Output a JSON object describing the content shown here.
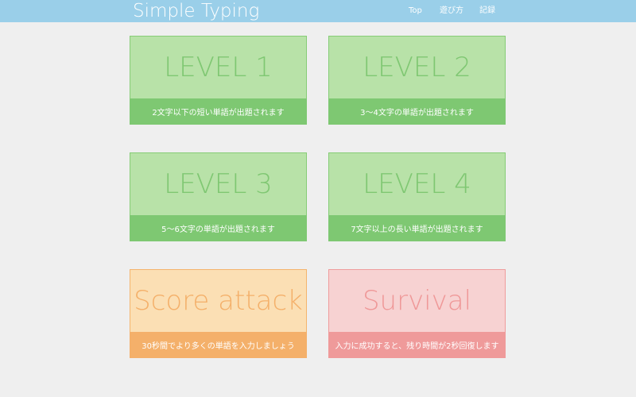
{
  "header": {
    "brand": "Simple Typing",
    "nav": [
      {
        "label": "Top"
      },
      {
        "label": "遊び方"
      },
      {
        "label": "記録"
      }
    ]
  },
  "modes": [
    {
      "title": "LEVEL 1",
      "description": "2文字以下の短い単語が出題されます",
      "color": "#7ec872"
    },
    {
      "title": "LEVEL 2",
      "description": "3〜4文字の単語が出題されます",
      "color": "#7ec872"
    },
    {
      "title": "LEVEL 3",
      "description": "5〜6文字の単語が出題されます",
      "color": "#7ec872"
    },
    {
      "title": "LEVEL 4",
      "description": "7文字以上の長い単語が出題されます",
      "color": "#7ec872"
    },
    {
      "title": "Score attack",
      "description": "30秒間でより多くの単語を入力しましょう",
      "color": "#f4b06a"
    },
    {
      "title": "Survival",
      "description": "入力に成功すると、残り時間が2秒回復します",
      "color": "#ef9a9a"
    }
  ],
  "colors": {
    "navbar": "#9acfe9",
    "background": "#efefef"
  }
}
